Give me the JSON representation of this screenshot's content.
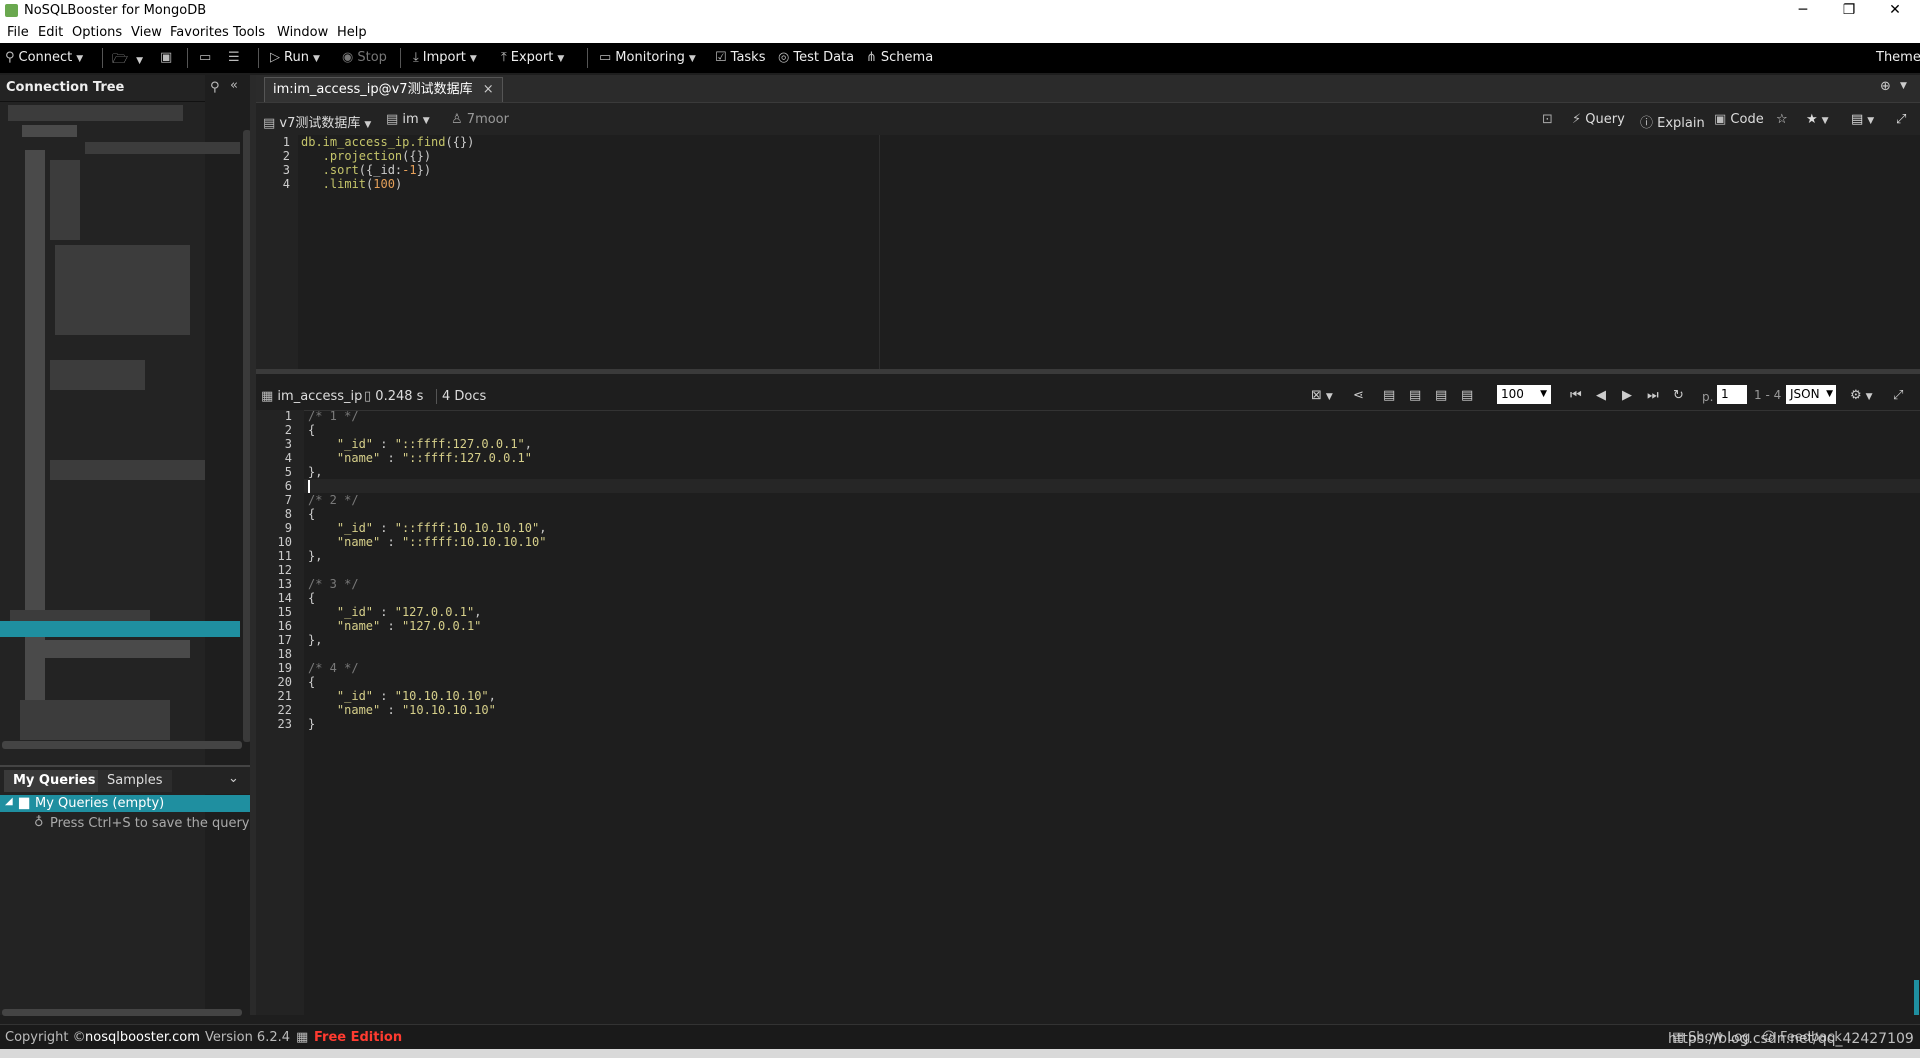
{
  "window": {
    "title": "NoSQLBooster for MongoDB",
    "controls": [
      "─",
      "❐",
      "✕"
    ]
  },
  "menu": [
    "File",
    "Edit",
    "Options",
    "View",
    "Favorites",
    "Tools",
    "Window",
    "Help"
  ],
  "toolbar": {
    "connect": "Connect",
    "run": "Run",
    "stop": "Stop",
    "import": "Import",
    "export": "Export",
    "monitoring": "Monitoring",
    "tasks": "Tasks",
    "test_data": "Test Data",
    "schema": "Schema",
    "theme": "Theme"
  },
  "sidebar": {
    "connection_tree_title": "Connection Tree",
    "tabs": [
      "My Queries",
      "Samples"
    ],
    "my_queries_root": "My Queries (empty)",
    "my_queries_hint": "Press Ctrl+S to save the query here"
  },
  "tab": {
    "label": "im:im_access_ip@v7测试数据库",
    "close": "×"
  },
  "query_bar": {
    "database": "v7测试数据库",
    "collection": "im",
    "user": "7moor",
    "query": "Query",
    "explain": "Explain",
    "code": "Code"
  },
  "editor": {
    "line_numbers": [
      "1",
      "2",
      "3",
      "4"
    ],
    "lines": [
      {
        "parts": [
          {
            "t": "db.im_access_ip.",
            "c": "fn"
          },
          {
            "t": "find",
            "c": "fn"
          },
          {
            "t": "({})",
            "c": "pn"
          }
        ]
      },
      {
        "parts": [
          {
            "t": "   .projection",
            "c": "fn"
          },
          {
            "t": "({})",
            "c": "pn"
          }
        ]
      },
      {
        "parts": [
          {
            "t": "   .sort",
            "c": "fn"
          },
          {
            "t": "({_id:",
            "c": "pn"
          },
          {
            "t": "-1",
            "c": "num"
          },
          {
            "t": "})",
            "c": "pn"
          }
        ]
      },
      {
        "parts": [
          {
            "t": "   .limit",
            "c": "fn"
          },
          {
            "t": "(",
            "c": "pn"
          },
          {
            "t": "100",
            "c": "num"
          },
          {
            "t": ")",
            "c": "pn"
          }
        ]
      }
    ]
  },
  "results": {
    "collection": "im_access_ip",
    "time": "0.248 s",
    "docs": "4 Docs",
    "page_size": "100",
    "page_prefix": "p.",
    "page": "1",
    "range": "1 - 4",
    "view_mode": "JSON",
    "line_numbers": [
      "1",
      "2",
      "3",
      "4",
      "5",
      "6",
      "7",
      "8",
      "9",
      "10",
      "11",
      "12",
      "13",
      "14",
      "15",
      "16",
      "17",
      "18",
      "19",
      "20",
      "21",
      "22",
      "23"
    ],
    "lines": [
      [
        {
          "t": "/* 1 */",
          "c": "cm"
        }
      ],
      [
        {
          "t": "{",
          "c": "pn"
        }
      ],
      [
        {
          "t": "    \"_id\"",
          "c": "key"
        },
        {
          "t": " : ",
          "c": "pn"
        },
        {
          "t": "\"::ffff:127.0.0.1\"",
          "c": "str"
        },
        {
          "t": ",",
          "c": "pn"
        }
      ],
      [
        {
          "t": "    \"name\"",
          "c": "key"
        },
        {
          "t": " : ",
          "c": "pn"
        },
        {
          "t": "\"::ffff:127.0.0.1\"",
          "c": "str"
        }
      ],
      [
        {
          "t": "},",
          "c": "pn"
        }
      ],
      [
        {
          "t": "",
          "c": "pn"
        }
      ],
      [
        {
          "t": "/* 2 */",
          "c": "cm"
        }
      ],
      [
        {
          "t": "{",
          "c": "pn"
        }
      ],
      [
        {
          "t": "    \"_id\"",
          "c": "key"
        },
        {
          "t": " : ",
          "c": "pn"
        },
        {
          "t": "\"::ffff:10.10.10.10\"",
          "c": "str"
        },
        {
          "t": ",",
          "c": "pn"
        }
      ],
      [
        {
          "t": "    \"name\"",
          "c": "key"
        },
        {
          "t": " : ",
          "c": "pn"
        },
        {
          "t": "\"::ffff:10.10.10.10\"",
          "c": "str"
        }
      ],
      [
        {
          "t": "},",
          "c": "pn"
        }
      ],
      [
        {
          "t": "",
          "c": "pn"
        }
      ],
      [
        {
          "t": "/* 3 */",
          "c": "cm"
        }
      ],
      [
        {
          "t": "{",
          "c": "pn"
        }
      ],
      [
        {
          "t": "    \"_id\"",
          "c": "key"
        },
        {
          "t": " : ",
          "c": "pn"
        },
        {
          "t": "\"127.0.0.1\"",
          "c": "str"
        },
        {
          "t": ",",
          "c": "pn"
        }
      ],
      [
        {
          "t": "    \"name\"",
          "c": "key"
        },
        {
          "t": " : ",
          "c": "pn"
        },
        {
          "t": "\"127.0.0.1\"",
          "c": "str"
        }
      ],
      [
        {
          "t": "},",
          "c": "pn"
        }
      ],
      [
        {
          "t": "",
          "c": "pn"
        }
      ],
      [
        {
          "t": "/* 4 */",
          "c": "cm"
        }
      ],
      [
        {
          "t": "{",
          "c": "pn"
        }
      ],
      [
        {
          "t": "    \"_id\"",
          "c": "key"
        },
        {
          "t": " : ",
          "c": "pn"
        },
        {
          "t": "\"10.10.10.10\"",
          "c": "str"
        },
        {
          "t": ",",
          "c": "pn"
        }
      ],
      [
        {
          "t": "    \"name\"",
          "c": "key"
        },
        {
          "t": " : ",
          "c": "pn"
        },
        {
          "t": "\"10.10.10.10\"",
          "c": "str"
        }
      ],
      [
        {
          "t": "}",
          "c": "pn"
        }
      ]
    ]
  },
  "status": {
    "copyright_prefix": "Copyright ©",
    "site": "nosqlbooster.com",
    "version": "Version 6.2.4",
    "edition": "Free Edition",
    "show_log": "Show Log",
    "feedback": "Feedback",
    "watermark": "https://blog.csdn.net/qq_42427109"
  },
  "colors": {
    "accent": "#1f8fa0",
    "edition_red": "#ff3b30"
  }
}
